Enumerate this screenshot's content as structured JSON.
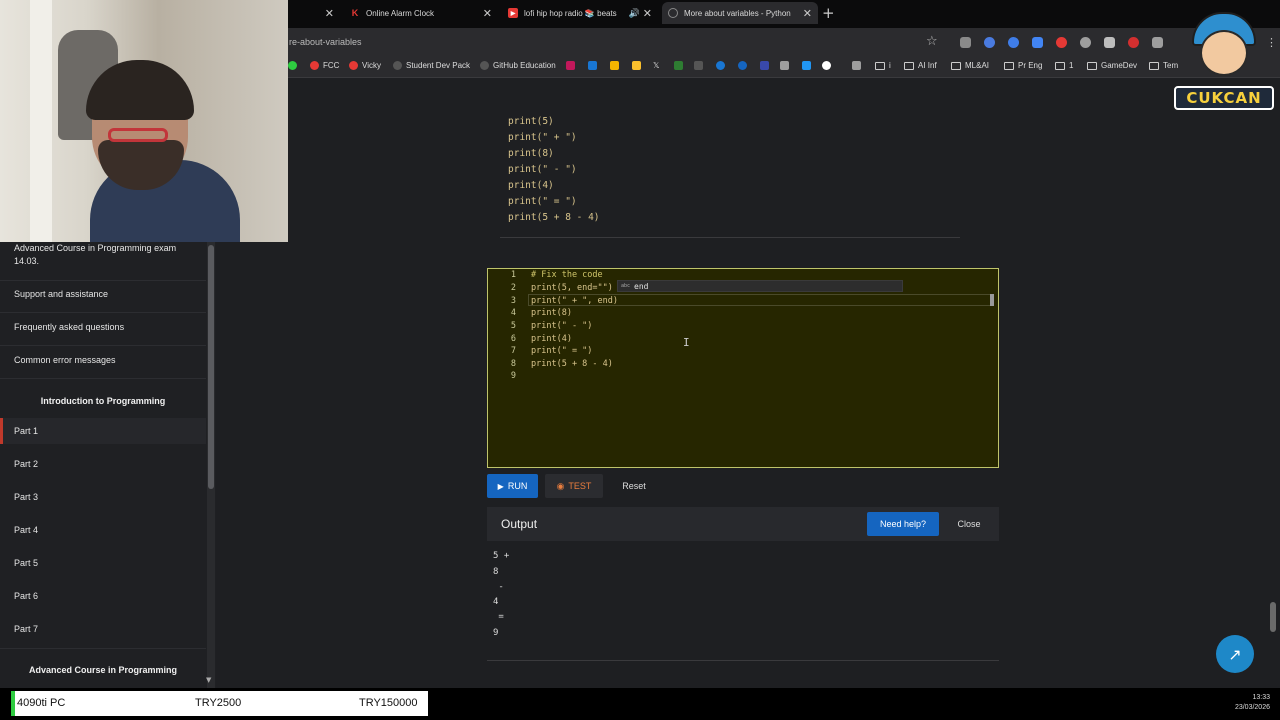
{
  "browser": {
    "tabs": [
      {
        "label": "",
        "icon": "tab-icon"
      },
      {
        "label": "Online Alarm Clock",
        "icon": "k-icon"
      },
      {
        "label": "lofi hip hop radio 📚 beats",
        "icon": "youtube-icon"
      },
      {
        "label": "More about variables - Python",
        "icon": "globe-icon"
      }
    ],
    "url": "re-about-variables",
    "bookmarks": [
      {
        "label": "FCC",
        "color": "#e53935"
      },
      {
        "label": "Vicky",
        "color": "#e53935"
      },
      {
        "label": "Student Dev Pack",
        "color": "#333333"
      },
      {
        "label": "GitHub Education",
        "color": "#333333"
      },
      {
        "label": "i",
        "color": ""
      },
      {
        "label": "AI Inf",
        "color": ""
      },
      {
        "label": "ML&AI",
        "color": ""
      },
      {
        "label": "Pr Eng",
        "color": ""
      },
      {
        "label": "1",
        "color": ""
      },
      {
        "label": "GameDev",
        "color": ""
      },
      {
        "label": "Tem",
        "color": ""
      }
    ]
  },
  "sidebar": {
    "exam_link": "Advanced Course in Programming exam 14.03.",
    "links": [
      "Support and assistance",
      "Frequently asked questions",
      "Common error messages"
    ],
    "section_intro": "Introduction to Programming",
    "parts": [
      "Part 1",
      "Part 2",
      "Part 3",
      "Part 4",
      "Part 5",
      "Part 6",
      "Part 7"
    ],
    "section_advanced": "Advanced Course in Programming"
  },
  "sample_code": [
    "print(5)",
    "print(\" + \")",
    "print(8)",
    "print(\" - \")",
    "print(4)",
    "print(\" = \")",
    "print(5 + 8 - 4)"
  ],
  "editor": {
    "line_numbers": [
      "1",
      "2",
      "3",
      "4",
      "5",
      "6",
      "7",
      "8",
      "9"
    ],
    "lines": [
      "# Fix the code",
      "print(5, end=\"\")",
      "print(\" + \", end)",
      "print(8)",
      "print(\" - \")",
      "print(4)",
      "print(\" = \")",
      "print(5 + 8 - 4)",
      ""
    ],
    "suggestion_icon": "abc",
    "suggestion": "end"
  },
  "buttons": {
    "run": "RUN",
    "test": "TEST",
    "reset": "Reset",
    "need_help": "Need help?",
    "close": "Close"
  },
  "output": {
    "title": "Output",
    "lines": [
      "5 +",
      "8",
      " -",
      "4",
      " =",
      "9"
    ]
  },
  "mascot": {
    "text": "CUKCAN"
  },
  "taskbar": {
    "widget": [
      "4090ti PC",
      "TRY2500",
      "TRY150000"
    ],
    "time": "13:33",
    "date": "23/03/2026"
  },
  "colors": {
    "accent": "#1565c0",
    "editor_bg": "#262600",
    "code": "#d8c48c"
  }
}
